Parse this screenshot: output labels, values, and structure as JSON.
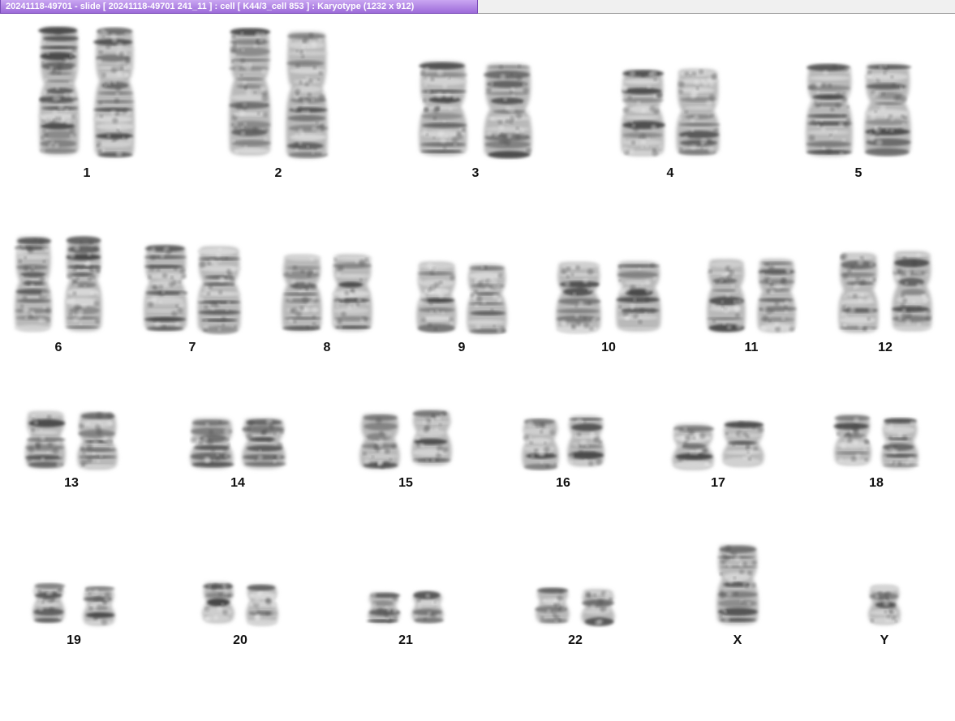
{
  "window": {
    "title": "20241118-49701 - slide [ 20241118-49701 241_11 ] : cell [ K44/3_cell 853 ] : Karyotype  (1232 x 912)"
  },
  "karyotype": {
    "chromosomes": [
      {
        "label": "1",
        "count": 2
      },
      {
        "label": "2",
        "count": 2
      },
      {
        "label": "3",
        "count": 2
      },
      {
        "label": "4",
        "count": 2
      },
      {
        "label": "5",
        "count": 2
      },
      {
        "label": "6",
        "count": 2
      },
      {
        "label": "7",
        "count": 2
      },
      {
        "label": "8",
        "count": 2
      },
      {
        "label": "9",
        "count": 2
      },
      {
        "label": "10",
        "count": 2
      },
      {
        "label": "11",
        "count": 2
      },
      {
        "label": "12",
        "count": 2
      },
      {
        "label": "13",
        "count": 2
      },
      {
        "label": "14",
        "count": 2
      },
      {
        "label": "15",
        "count": 2
      },
      {
        "label": "16",
        "count": 2
      },
      {
        "label": "17",
        "count": 2
      },
      {
        "label": "18",
        "count": 2
      },
      {
        "label": "19",
        "count": 2
      },
      {
        "label": "20",
        "count": 2
      },
      {
        "label": "21",
        "count": 2
      },
      {
        "label": "22",
        "count": 2
      },
      {
        "label": "X",
        "count": 1
      },
      {
        "label": "Y",
        "count": 1
      }
    ]
  }
}
